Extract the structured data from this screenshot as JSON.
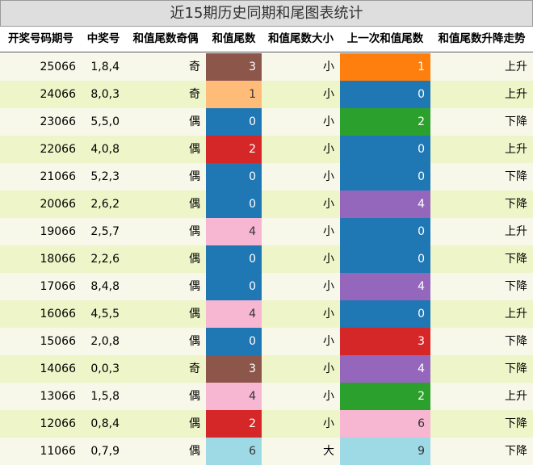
{
  "title": "近15期历史同期和尾图表统计",
  "headers": [
    "开奖号码期号",
    "中奖号",
    "和值尾数奇偶",
    "和值尾数",
    "和值尾数大小",
    "上一次和值尾数",
    "和值尾数升降走势"
  ],
  "colors": {
    "row_odd": "#f8f8ea",
    "row_even": "#eef5c8",
    "digit": {
      "0": "#1f77b4",
      "1": "#ff7f0e",
      "2": "#d62728",
      "3": "#8c564b",
      "4": "#f7b6d2",
      "6": "#9edae5",
      "9": "#9edae5"
    },
    "digit_prev": {
      "0": "#1f77b4",
      "1": "#ff7f0e",
      "2": "#2ca02c",
      "3": "#d62728",
      "4": "#9467bd",
      "6": "#f7b6d2",
      "9": "#9edae5"
    },
    "digit_cur_override": {
      "1": "#ffbb78"
    }
  },
  "chart_data": {
    "type": "table",
    "title": "近15期历史同期和尾图表统计",
    "columns": [
      "开奖号码期号",
      "中奖号",
      "和值尾数奇偶",
      "和值尾数",
      "和值尾数大小",
      "上一次和值尾数",
      "和值尾数升降走势"
    ],
    "rows": [
      [
        "25066",
        "1,8,4",
        "奇",
        "3",
        "小",
        "1",
        "上升"
      ],
      [
        "24066",
        "8,0,3",
        "奇",
        "1",
        "小",
        "0",
        "上升"
      ],
      [
        "23066",
        "5,5,0",
        "偶",
        "0",
        "小",
        "2",
        "下降"
      ],
      [
        "22066",
        "4,0,8",
        "偶",
        "2",
        "小",
        "0",
        "上升"
      ],
      [
        "21066",
        "5,2,3",
        "偶",
        "0",
        "小",
        "0",
        "下降"
      ],
      [
        "20066",
        "2,6,2",
        "偶",
        "0",
        "小",
        "4",
        "下降"
      ],
      [
        "19066",
        "2,5,7",
        "偶",
        "4",
        "小",
        "0",
        "上升"
      ],
      [
        "18066",
        "2,2,6",
        "偶",
        "0",
        "小",
        "0",
        "下降"
      ],
      [
        "17066",
        "8,4,8",
        "偶",
        "0",
        "小",
        "4",
        "下降"
      ],
      [
        "16066",
        "4,5,5",
        "偶",
        "4",
        "小",
        "0",
        "上升"
      ],
      [
        "15066",
        "2,0,8",
        "偶",
        "0",
        "小",
        "3",
        "下降"
      ],
      [
        "14066",
        "0,0,3",
        "奇",
        "3",
        "小",
        "4",
        "下降"
      ],
      [
        "13066",
        "1,5,8",
        "偶",
        "4",
        "小",
        "2",
        "上升"
      ],
      [
        "12066",
        "0,8,4",
        "偶",
        "2",
        "小",
        "6",
        "下降"
      ],
      [
        "11066",
        "0,7,9",
        "偶",
        "6",
        "大",
        "9",
        "下降"
      ]
    ]
  }
}
